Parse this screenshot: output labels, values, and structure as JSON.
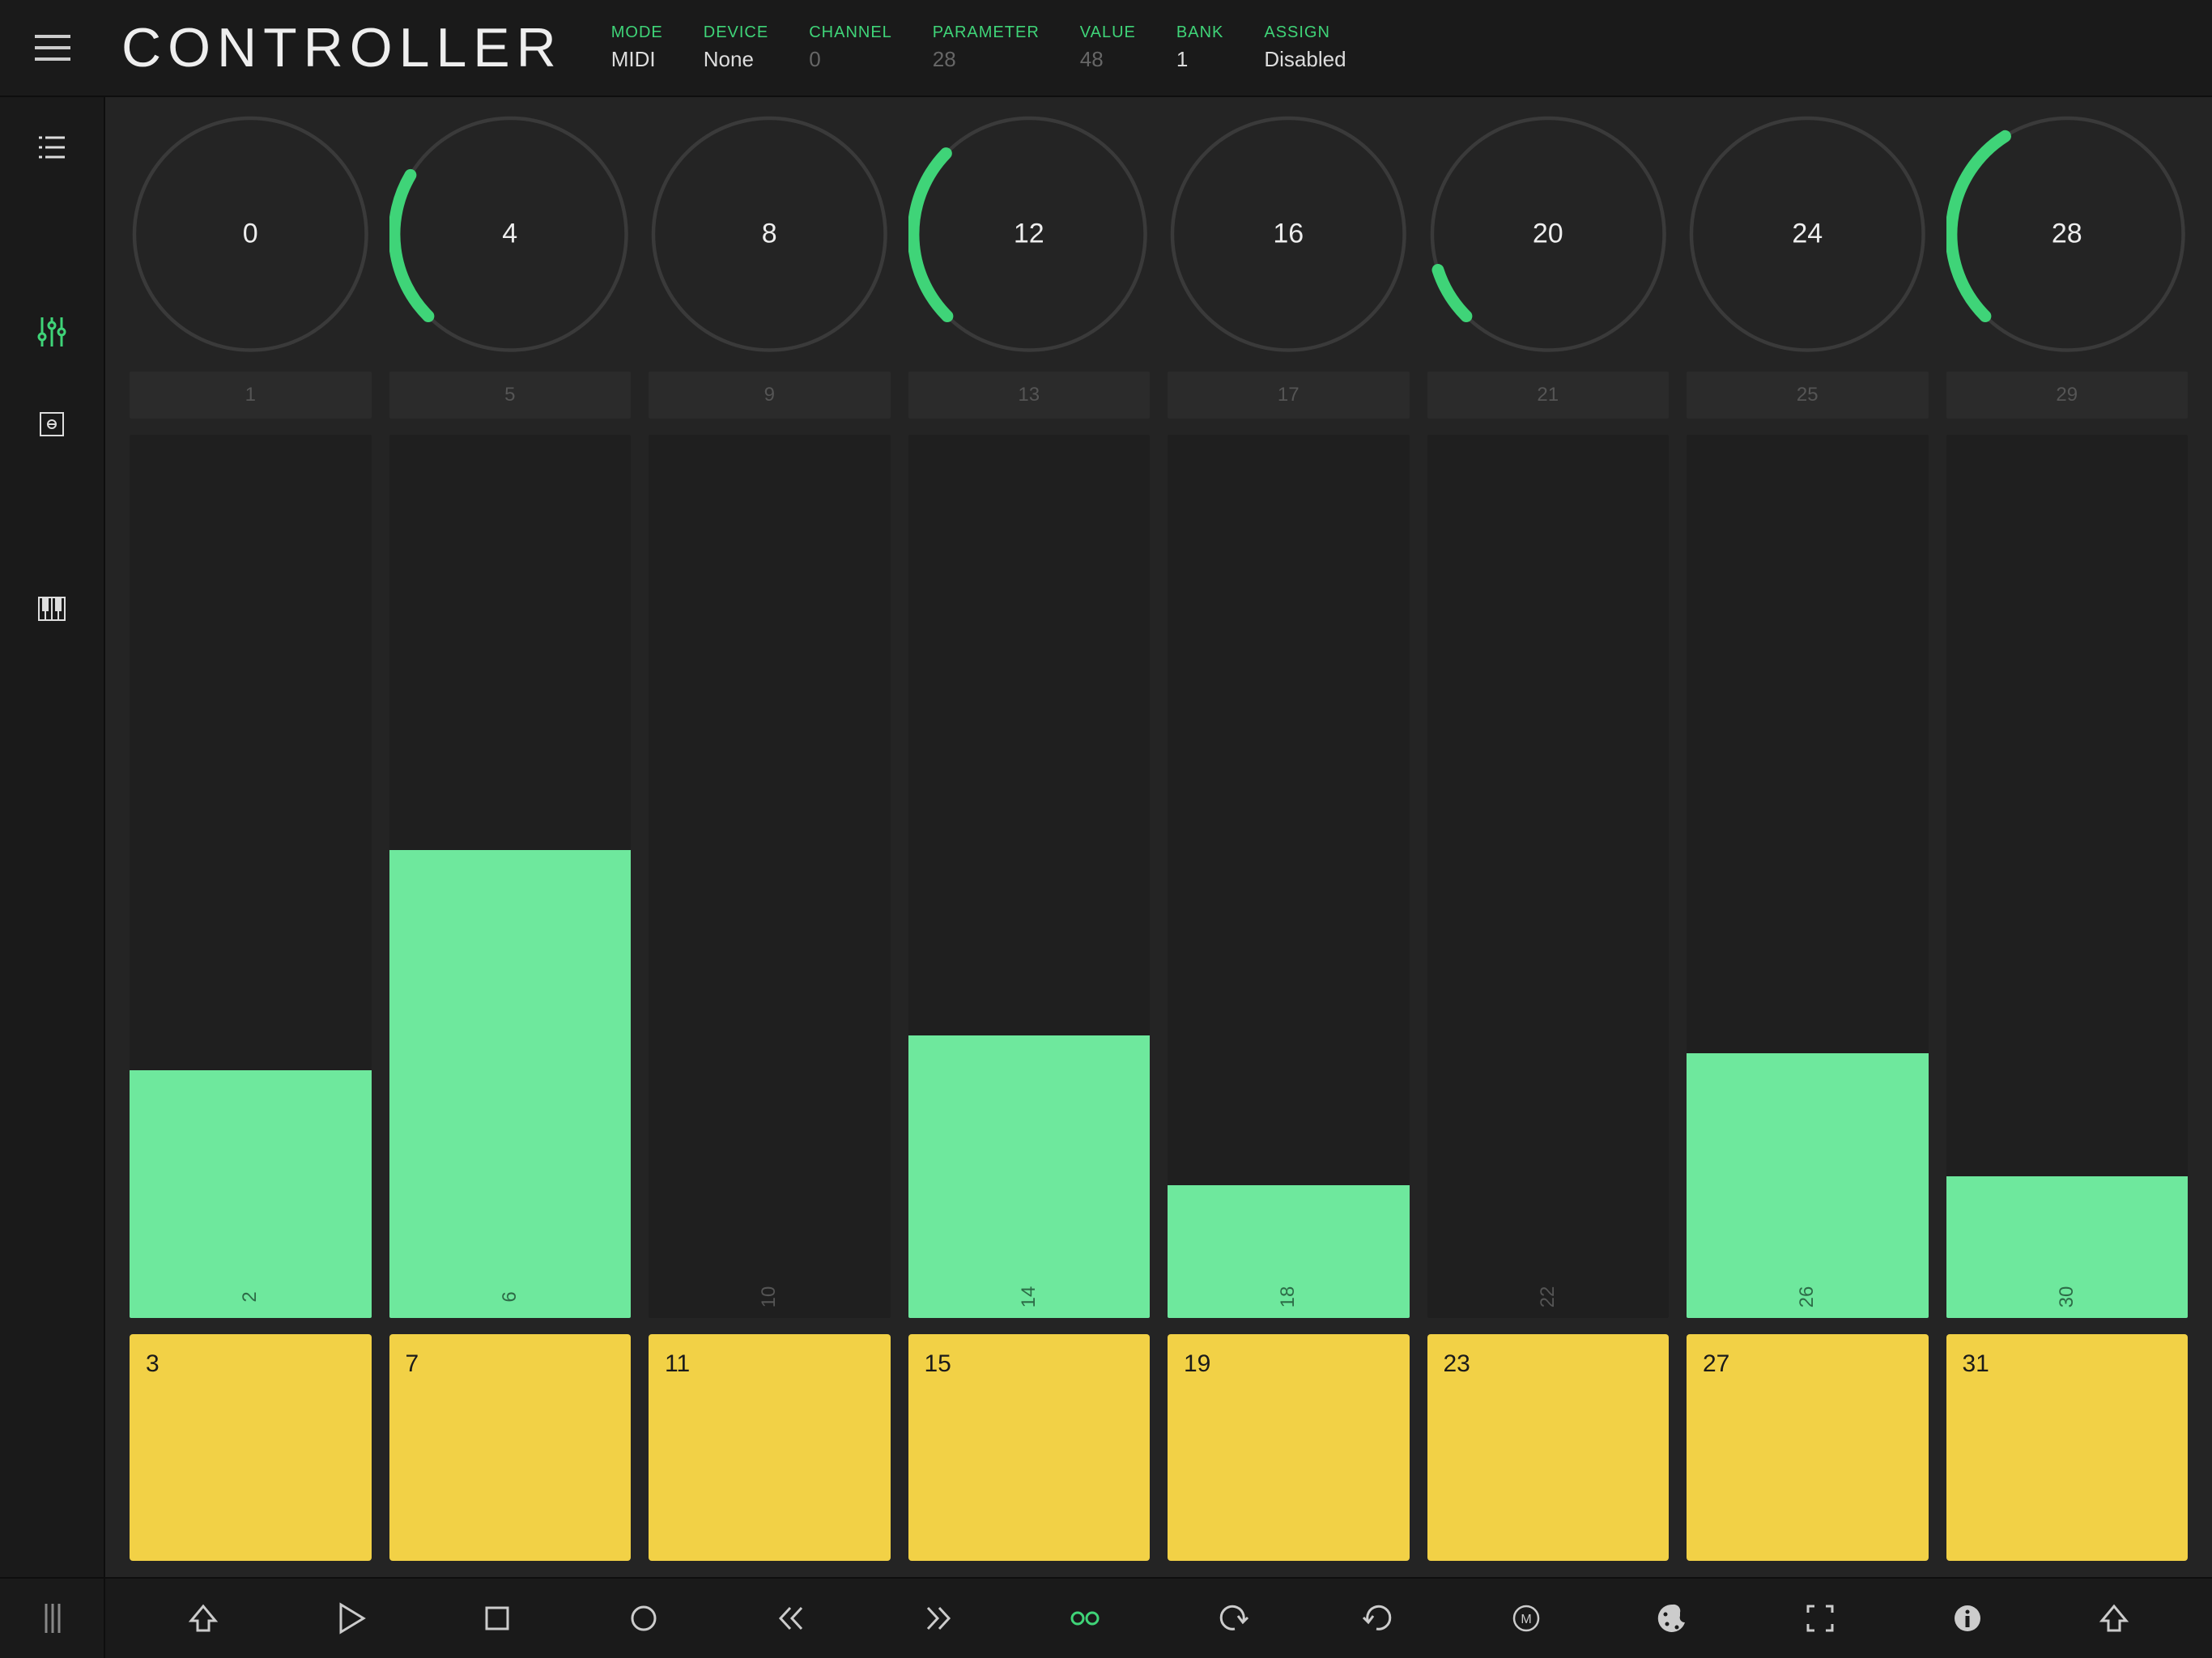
{
  "header": {
    "title": "CONTROLLER",
    "status": [
      {
        "label": "MODE",
        "value": "MIDI",
        "dim": false
      },
      {
        "label": "DEVICE",
        "value": "None",
        "dim": false
      },
      {
        "label": "CHANNEL",
        "value": "0",
        "dim": true
      },
      {
        "label": "PARAMETER",
        "value": "28",
        "dim": true
      },
      {
        "label": "VALUE",
        "value": "48",
        "dim": true
      },
      {
        "label": "BANK",
        "value": "1",
        "dim": false
      },
      {
        "label": "ASSIGN",
        "value": "Disabled",
        "dim": false
      }
    ]
  },
  "knobs": [
    {
      "label": "0",
      "pct": 0
    },
    {
      "label": "4",
      "pct": 28
    },
    {
      "label": "8",
      "pct": 0
    },
    {
      "label": "12",
      "pct": 33
    },
    {
      "label": "16",
      "pct": 0
    },
    {
      "label": "20",
      "pct": 10
    },
    {
      "label": "24",
      "pct": 0
    },
    {
      "label": "28",
      "pct": 38
    }
  ],
  "small_buttons": [
    "1",
    "5",
    "9",
    "13",
    "17",
    "21",
    "25",
    "29"
  ],
  "sliders": [
    {
      "label": "2",
      "pct": 28
    },
    {
      "label": "6",
      "pct": 53
    },
    {
      "label": "10",
      "pct": 0
    },
    {
      "label": "14",
      "pct": 32
    },
    {
      "label": "18",
      "pct": 15
    },
    {
      "label": "22",
      "pct": 0
    },
    {
      "label": "26",
      "pct": 30
    },
    {
      "label": "30",
      "pct": 16
    }
  ],
  "pads": [
    "3",
    "7",
    "11",
    "15",
    "19",
    "23",
    "27",
    "31"
  ],
  "colors": {
    "accent": "#3fd478",
    "slider_fill": "#6ee89d",
    "pad": "#f2d146"
  }
}
